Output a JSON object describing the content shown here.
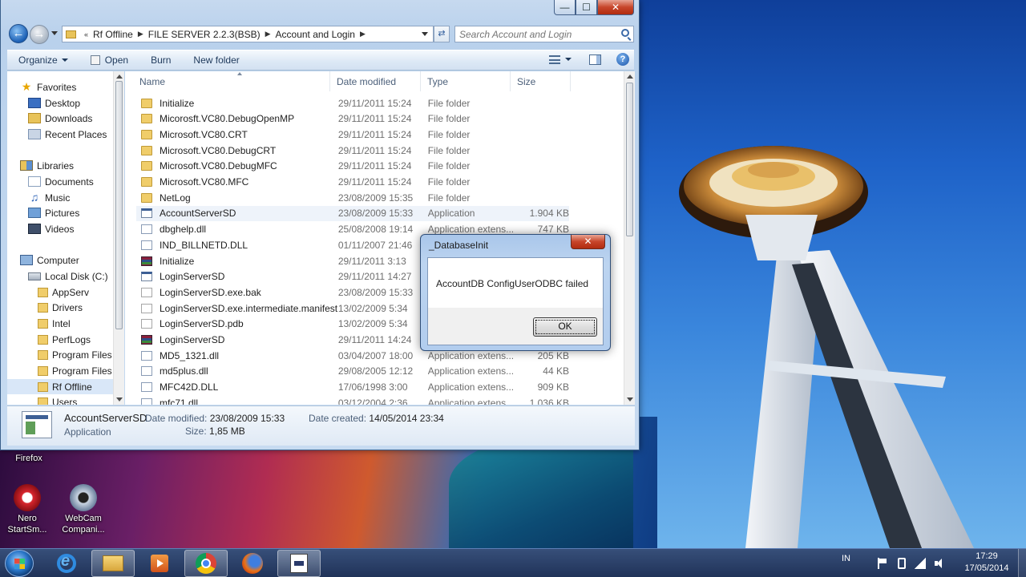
{
  "desktop": {
    "icons": [
      {
        "label": "Firefox",
        "icon": "firefox-icon"
      },
      {
        "label": "Nero StartSm...",
        "icon": "nero-icon"
      },
      {
        "label": "WebCam Compani...",
        "icon": "webcam-icon"
      }
    ]
  },
  "window": {
    "caption_buttons": {
      "minimize": "—",
      "maximize": "☐",
      "close": "✕"
    },
    "breadcrumb": [
      "Rf Offline",
      "FILE SERVER 2.2.3(BSB)",
      "Account and Login"
    ],
    "breadcrumb_overflow": "«",
    "search_placeholder": "Search Account and Login",
    "toolbar": {
      "organize": "Organize",
      "open": "Open",
      "burn": "Burn",
      "new_folder": "New folder",
      "help": "?"
    },
    "nav": {
      "favorites": "Favorites",
      "desktop": "Desktop",
      "downloads": "Downloads",
      "recent": "Recent Places",
      "libraries": "Libraries",
      "documents": "Documents",
      "music": "Music",
      "pictures": "Pictures",
      "videos": "Videos",
      "computer": "Computer",
      "local_disk": "Local Disk (C:)",
      "folders": [
        "AppServ",
        "Drivers",
        "Intel",
        "PerfLogs",
        "Program Files",
        "Program Files (",
        "Rf Offline",
        "Users"
      ]
    },
    "columns": {
      "name": "Name",
      "date": "Date modified",
      "type": "Type",
      "size": "Size"
    },
    "files": [
      {
        "name": "Initialize",
        "date": "29/11/2011 15:24",
        "type": "File folder",
        "size": "",
        "icon": "folder-icon"
      },
      {
        "name": "Micorosft.VC80.DebugOpenMP",
        "date": "29/11/2011 15:24",
        "type": "File folder",
        "size": "",
        "icon": "folder-icon"
      },
      {
        "name": "Microsoft.VC80.CRT",
        "date": "29/11/2011 15:24",
        "type": "File folder",
        "size": "",
        "icon": "folder-icon"
      },
      {
        "name": "Microsoft.VC80.DebugCRT",
        "date": "29/11/2011 15:24",
        "type": "File folder",
        "size": "",
        "icon": "folder-icon"
      },
      {
        "name": "Microsoft.VC80.DebugMFC",
        "date": "29/11/2011 15:24",
        "type": "File folder",
        "size": "",
        "icon": "folder-icon"
      },
      {
        "name": "Microsoft.VC80.MFC",
        "date": "29/11/2011 15:24",
        "type": "File folder",
        "size": "",
        "icon": "folder-icon"
      },
      {
        "name": "NetLog",
        "date": "23/08/2009 15:35",
        "type": "File folder",
        "size": "",
        "icon": "folder-icon"
      },
      {
        "name": "AccountServerSD",
        "date": "23/08/2009 15:33",
        "type": "Application",
        "size": "1.904 KB",
        "icon": "application-icon"
      },
      {
        "name": "dbghelp.dll",
        "date": "25/08/2008 19:14",
        "type": "Application extens...",
        "size": "747 KB",
        "icon": "dll-icon"
      },
      {
        "name": "IND_BILLNETD.DLL",
        "date": "01/11/2007 21:46",
        "type": "Application extens...",
        "size": "",
        "icon": "dll-icon"
      },
      {
        "name": "Initialize",
        "date": "29/11/2011 3:13",
        "type": "",
        "size": "",
        "icon": "winrar-icon"
      },
      {
        "name": "LoginServerSD",
        "date": "29/11/2011 14:27",
        "type": "",
        "size": "",
        "icon": "application-icon"
      },
      {
        "name": "LoginServerSD.exe.bak",
        "date": "23/08/2009 15:33",
        "type": "",
        "size": "",
        "icon": "file-icon"
      },
      {
        "name": "LoginServerSD.exe.intermediate.manifest",
        "date": "13/02/2009 5:34",
        "type": "",
        "size": "",
        "icon": "file-icon"
      },
      {
        "name": "LoginServerSD.pdb",
        "date": "13/02/2009 5:34",
        "type": "",
        "size": "",
        "icon": "file-icon"
      },
      {
        "name": "LoginServerSD",
        "date": "29/11/2011 14:24",
        "type": "",
        "size": "",
        "icon": "winrar-icon"
      },
      {
        "name": "MD5_1321.dll",
        "date": "03/04/2007 18:00",
        "type": "Application extens...",
        "size": "205 KB",
        "icon": "dll-icon"
      },
      {
        "name": "md5plus.dll",
        "date": "29/08/2005 12:12",
        "type": "Application extens...",
        "size": "44 KB",
        "icon": "dll-icon"
      },
      {
        "name": "MFC42D.DLL",
        "date": "17/06/1998 3:00",
        "type": "Application extens...",
        "size": "909 KB",
        "icon": "dll-icon"
      },
      {
        "name": "mfc71.dll",
        "date": "03/12/2004 2:36",
        "type": "Application extens...",
        "size": "1.036 KB",
        "icon": "dll-icon"
      }
    ],
    "details": {
      "name": "AccountServerSD",
      "type": "Application",
      "date_modified_label": "Date modified:",
      "date_modified": "23/08/2009 15:33",
      "date_created_label": "Date created:",
      "date_created": "14/05/2014 23:34",
      "size_label": "Size:",
      "size": "1,85 MB"
    }
  },
  "dialog": {
    "title": "_DatabaseInit",
    "message": "AccountDB ConfigUserODBC failed",
    "ok": "OK",
    "close": "✕"
  },
  "taskbar": {
    "tray_lang": "IN",
    "time": "17:29",
    "date": "17/05/2014"
  }
}
